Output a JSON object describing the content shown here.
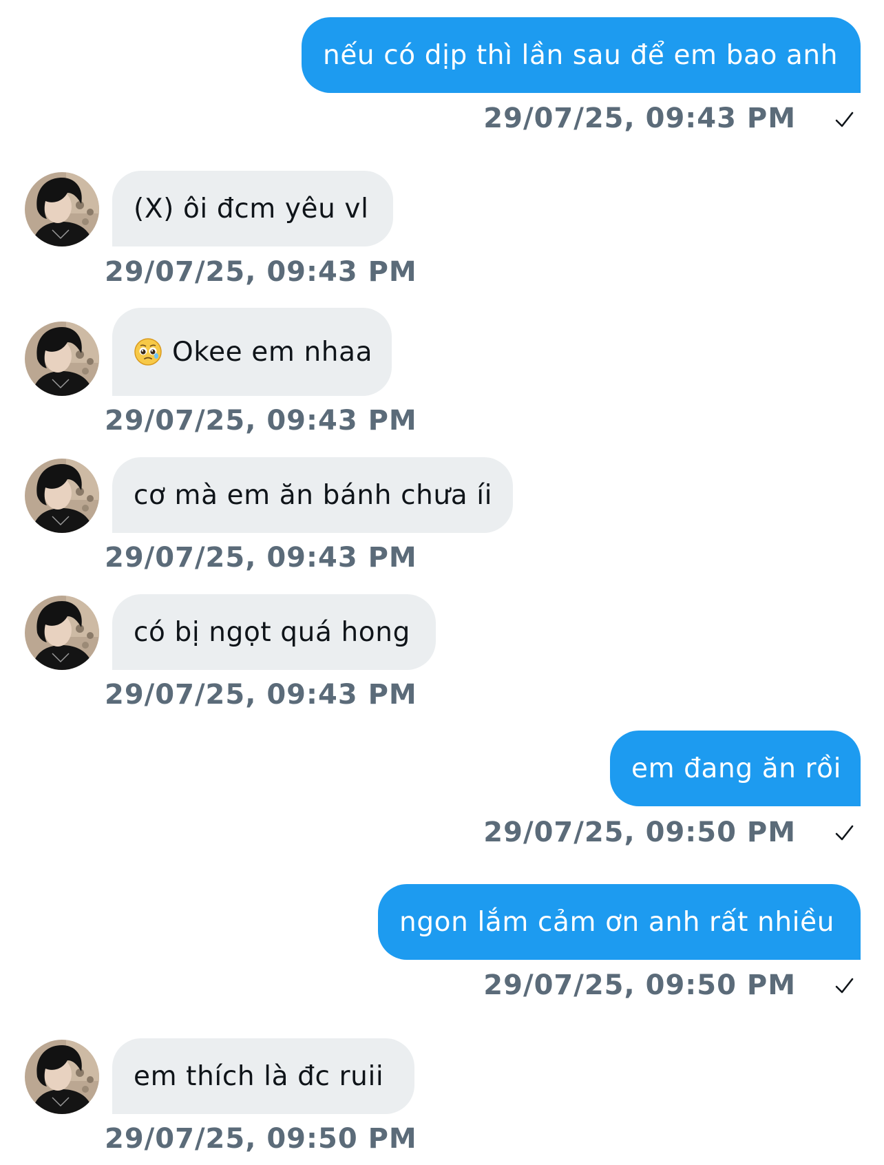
{
  "conversation": {
    "messages": [
      {
        "direction": "sent",
        "text": "nếu có dịp thì lần sau để em bao anh",
        "time": "29/07/25, 09:43 PM",
        "status": "sent-check-icon"
      },
      {
        "direction": "received",
        "text": "(X) ôi đcm yêu vl",
        "time": "29/07/25, 09:43 PM"
      },
      {
        "direction": "received",
        "emoji": "pleading-face-emoji-icon",
        "text": "Okee em nhaa",
        "time": "29/07/25, 09:43 PM"
      },
      {
        "direction": "received",
        "text": "cơ mà em ăn bánh chưa íi",
        "time": "29/07/25, 09:43 PM"
      },
      {
        "direction": "received",
        "text": "có bị ngọt quá hong",
        "time": "29/07/25, 09:43 PM"
      },
      {
        "direction": "sent",
        "text": "em đang ăn rồi",
        "time": "29/07/25, 09:50 PM",
        "status": "sent-check-icon"
      },
      {
        "direction": "sent",
        "text": "ngon lắm cảm ơn anh rất nhiều",
        "time": "29/07/25, 09:50 PM",
        "status": "sent-check-icon"
      },
      {
        "direction": "received",
        "text": "em thích là đc ruii",
        "time": "29/07/25, 09:50 PM"
      }
    ]
  },
  "colors": {
    "sent_bubble": "#1d9bf0",
    "received_bubble": "#ebeef0",
    "timestamp": "#5b6b79",
    "received_text": "#0f1419"
  }
}
